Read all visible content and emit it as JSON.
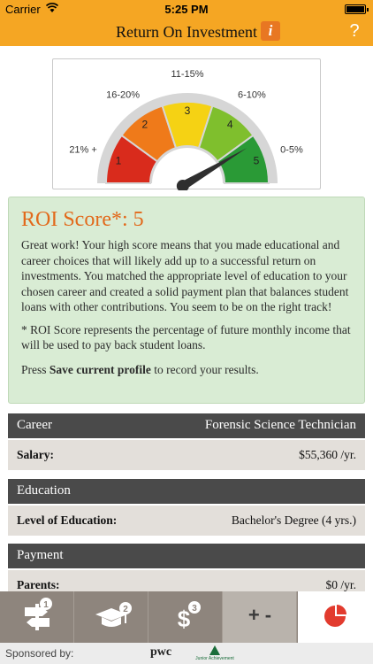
{
  "status": {
    "carrier": "Carrier",
    "time": "5:25 PM"
  },
  "nav": {
    "title": "Return On Investment",
    "info_glyph": "i",
    "help_glyph": "?"
  },
  "gauge": {
    "labels": [
      "21% +",
      "16-20%",
      "11-15%",
      "6-10%",
      "0-5%"
    ],
    "segments": [
      "1",
      "2",
      "3",
      "4",
      "5"
    ],
    "colors": [
      "#d92b1c",
      "#ef7a1a",
      "#f5d214",
      "#7fbf2d",
      "#2a9a36"
    ],
    "score_segment": 5
  },
  "roi": {
    "score_label": "ROI Score*: 5",
    "message": "Great work! Your high score means that you made educational and career choices that will likely add up to a successful return on investments. You matched the appropriate level of education to your chosen career and created a solid payment plan that balances student loans with other contributions. You seem to be on the right track!",
    "note": "* ROI Score represents the percentage of future monthly income that will be used to pay back student loans.",
    "press_prefix": "Press ",
    "press_bold": "Save current profile",
    "press_suffix": " to record your results."
  },
  "career": {
    "header": "Career",
    "value": "Forensic Science Technician",
    "row_label": "Salary:",
    "row_value": "$55,360 /yr."
  },
  "education": {
    "header": "Education",
    "row_label": "Level of Education:",
    "row_value": "Bachelor's Degree (4 yrs.)"
  },
  "payment": {
    "header": "Payment",
    "row_label": "Parents:",
    "row_value": "$0 /yr."
  },
  "tabs": [
    {
      "icon": "career-signpost-icon",
      "badge": "1"
    },
    {
      "icon": "graduation-cap-icon",
      "badge": "2"
    },
    {
      "icon": "dollar-icon",
      "badge": "3"
    },
    {
      "icon": "plus-minus-icon",
      "label": "+ -"
    },
    {
      "icon": "pie-chart-icon"
    }
  ],
  "sponsor": {
    "label": "Sponsored by:",
    "pwc": "pwc",
    "ja": "Junior Achievement"
  }
}
